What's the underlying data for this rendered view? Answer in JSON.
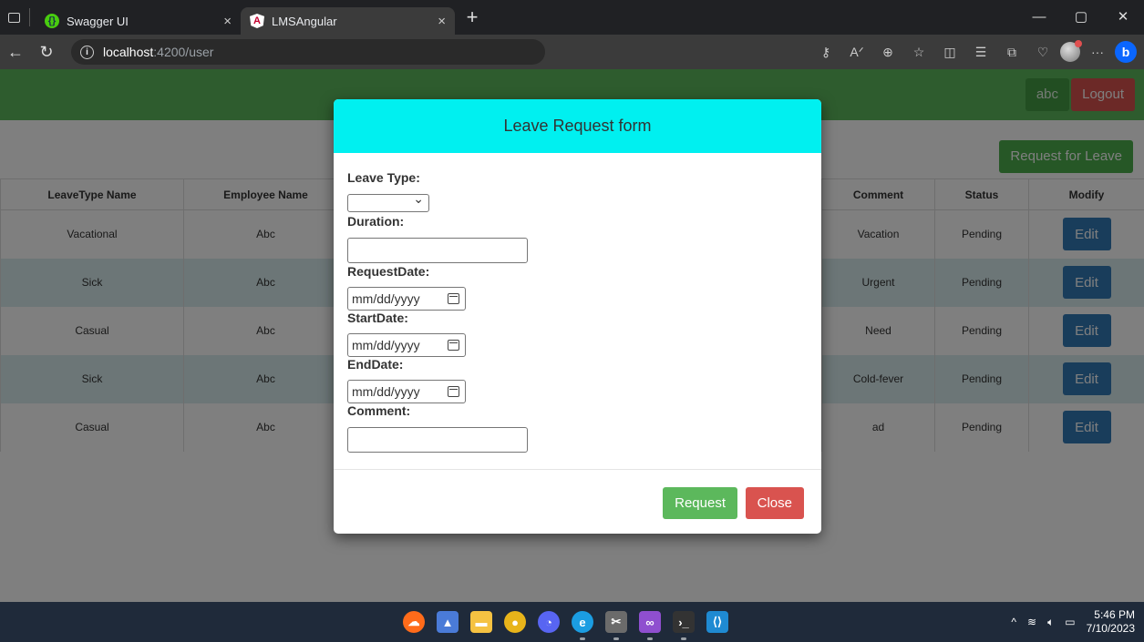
{
  "browser": {
    "tabs": [
      {
        "title": "Swagger UI",
        "favicon": "swagger-favicon",
        "active": false
      },
      {
        "title": "LMSAngular",
        "favicon": "angular-favicon",
        "active": true
      }
    ],
    "tab_close_glyph": "×",
    "new_tab_glyph": "+",
    "url_host": "localhost",
    "url_path": ":4200/user",
    "window_controls": {
      "minimize": "—",
      "maximize": "▢",
      "close": "✕"
    }
  },
  "header": {
    "username": "abc",
    "logout_label": "Logout",
    "brand_color": "#5cb85c"
  },
  "toolbar": {
    "request_leave_label": "Request for Leave"
  },
  "table": {
    "columns": [
      "LeaveType Name",
      "Employee Name",
      "",
      "",
      "",
      "",
      "",
      "Comment",
      "Status",
      "Modify"
    ],
    "rows": [
      {
        "leave_type": "Vacational",
        "employee": "Abc",
        "comment": "Vacation",
        "status": "Pending"
      },
      {
        "leave_type": "Sick",
        "employee": "Abc",
        "comment": "Urgent",
        "status": "Pending"
      },
      {
        "leave_type": "Casual",
        "employee": "Abc",
        "comment": "Need",
        "status": "Pending"
      },
      {
        "leave_type": "Sick",
        "employee": "Abc",
        "comment": "Cold-fever",
        "status": "Pending"
      },
      {
        "leave_type": "Casual",
        "employee": "Abc",
        "comment": "ad",
        "status": "Pending"
      }
    ],
    "edit_label": "Edit"
  },
  "modal": {
    "title": "Leave Request form",
    "header_color": "#00f0f0",
    "fields": {
      "leave_type_label": "Leave Type:",
      "leave_type_value": "",
      "duration_label": "Duration:",
      "duration_value": "",
      "request_date_label": "RequestDate:",
      "request_date_placeholder": "mm/dd/yyyy",
      "start_date_label": "StartDate:",
      "start_date_placeholder": "mm/dd/yyyy",
      "end_date_label": "EndDate:",
      "end_date_placeholder": "mm/dd/yyyy",
      "comment_label": "Comment:",
      "comment_value": ""
    },
    "request_label": "Request",
    "close_label": "Close"
  },
  "taskbar": {
    "time": "5:46 PM",
    "date": "7/10/2023",
    "tray_chevron": "^"
  }
}
